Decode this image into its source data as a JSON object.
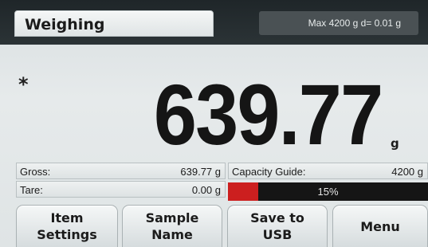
{
  "header": {
    "mode_title": "Weighing",
    "capacity_spec": "Max 4200 g   d= 0.01 g"
  },
  "display": {
    "stability_indicator": "*",
    "weight_value": "639.77",
    "unit": "g"
  },
  "info": {
    "gross_label": "Gross:",
    "gross_value": "639.77 g",
    "tare_label": "Tare:",
    "tare_value": "0.00 g",
    "capacity_label": "Capacity Guide:",
    "capacity_value": "4200 g",
    "capacity_percent_text": "15%",
    "capacity_fraction": 0.15
  },
  "softkeys": {
    "item_settings": [
      "Item",
      "Settings"
    ],
    "sample_name": [
      "Sample",
      "Name"
    ],
    "save_usb": [
      "Save to",
      "USB"
    ],
    "menu": "Menu"
  },
  "colors": {
    "capacity_fill": "#cc1f1f",
    "header_bg": "#1f2629"
  }
}
